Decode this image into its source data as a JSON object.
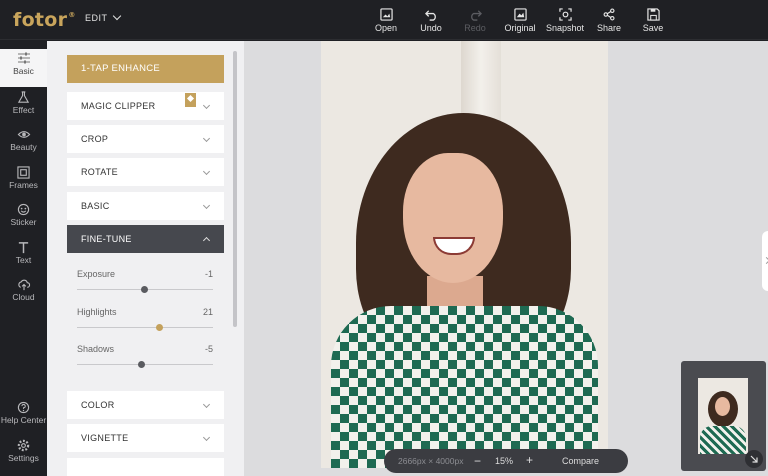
{
  "app": {
    "logo": "fotor",
    "logo_mark": "®",
    "menu": "EDIT"
  },
  "toolbar": [
    {
      "label": "Open",
      "icon": "image-open-icon",
      "enabled": true
    },
    {
      "label": "Undo",
      "icon": "undo-icon",
      "enabled": true
    },
    {
      "label": "Redo",
      "icon": "redo-icon",
      "enabled": false
    },
    {
      "label": "Original",
      "icon": "original-icon",
      "enabled": true
    },
    {
      "label": "Snapshot",
      "icon": "snapshot-icon",
      "enabled": true
    },
    {
      "label": "Share",
      "icon": "share-icon",
      "enabled": true
    },
    {
      "label": "Save",
      "icon": "save-icon",
      "enabled": true
    }
  ],
  "rail": [
    {
      "label": "Basic",
      "icon": "sliders-icon",
      "active": true
    },
    {
      "label": "Effect",
      "icon": "flask-icon"
    },
    {
      "label": "Beauty",
      "icon": "eye-icon"
    },
    {
      "label": "Frames",
      "icon": "frame-icon"
    },
    {
      "label": "Sticker",
      "icon": "sticker-icon"
    },
    {
      "label": "Text",
      "icon": "text-icon"
    },
    {
      "label": "Cloud",
      "icon": "cloud-upload-icon"
    }
  ],
  "rail_bottom": [
    {
      "label": "Help Center",
      "icon": "help-icon"
    },
    {
      "label": "Settings",
      "icon": "gear-icon"
    }
  ],
  "panel": {
    "enhance": "1-TAP ENHANCE",
    "sections": {
      "magic_clipper": "MAGIC CLIPPER",
      "crop": "CROP",
      "rotate": "ROTATE",
      "basic": "BASIC",
      "fine_tune": "FINE-TUNE",
      "color": "COLOR",
      "vignette": "VIGNETTE"
    },
    "sliders": {
      "exposure": {
        "label": "Exposure",
        "value": "-1"
      },
      "highlights": {
        "label": "Highlights",
        "value": "21"
      },
      "shadows": {
        "label": "Shadows",
        "value": "-5"
      }
    }
  },
  "canvas": {
    "dimensions": "2666px × 4000px",
    "zoom": "15%",
    "minus": "−",
    "plus": "+",
    "compare": "Compare"
  },
  "colors": {
    "accent": "#c4a15c",
    "dark": "#1f2024"
  }
}
